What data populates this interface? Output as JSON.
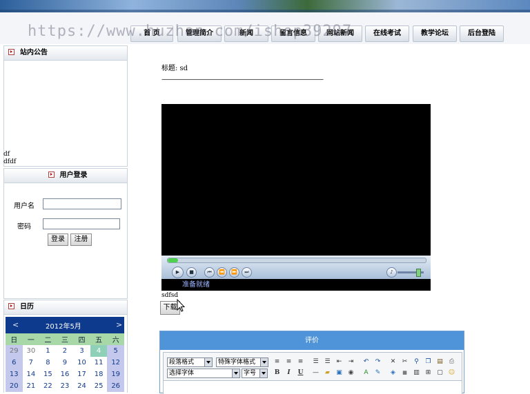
{
  "watermark": "https://www.huzhan.com/ishop39297",
  "nav": {
    "tabs": [
      "首 页",
      "管理简介",
      "新闻",
      "留言信息",
      "网站新闻",
      "在线考试",
      "教学论坛",
      "后台登陆"
    ]
  },
  "sidebar": {
    "notice": {
      "title": "站内公告",
      "items": [
        "df",
        "dfdf"
      ]
    },
    "login": {
      "title": "用户登录",
      "username_label": "用户名",
      "password_label": "密码",
      "username_value": "",
      "password_value": "",
      "login_button": "登录",
      "register_button": "注册"
    },
    "calendar": {
      "title": "日历",
      "prev": "<",
      "next": ">",
      "month_label": "2012年5月",
      "weekdays": [
        "日",
        "一",
        "二",
        "三",
        "四",
        "五",
        "六"
      ],
      "rows": [
        [
          "29",
          "30",
          "1",
          "2",
          "3",
          "4",
          "5"
        ],
        [
          "6",
          "7",
          "8",
          "9",
          "10",
          "11",
          "12"
        ],
        [
          "13",
          "14",
          "15",
          "16",
          "17",
          "18",
          "19"
        ],
        [
          "20",
          "21",
          "22",
          "23",
          "24",
          "25",
          "26"
        ]
      ],
      "today": "4"
    }
  },
  "main": {
    "title_line": "标题: sd",
    "separator": "——————————————————————————",
    "player": {
      "status": "准备就绪",
      "progress_fraction": 0.04,
      "volume_fraction": 0.7
    },
    "description": "sdfsd",
    "download_button": "下载",
    "review": {
      "title": "评价",
      "selects": {
        "paragraph_format": "段落格式",
        "special_font": "特殊字体格式",
        "font": "选择字体",
        "font_size": "字号"
      },
      "buttons": {
        "bold": "B",
        "italic": "I",
        "underline": "U"
      }
    }
  },
  "colors": {
    "calendar_header": "#0d3a8c",
    "calendar_weekday_row": "#a8d8a8",
    "calendar_weekend": "#c3c8ec",
    "calendar_today": "#8fd0b8",
    "review_header": "#4f94d9"
  }
}
